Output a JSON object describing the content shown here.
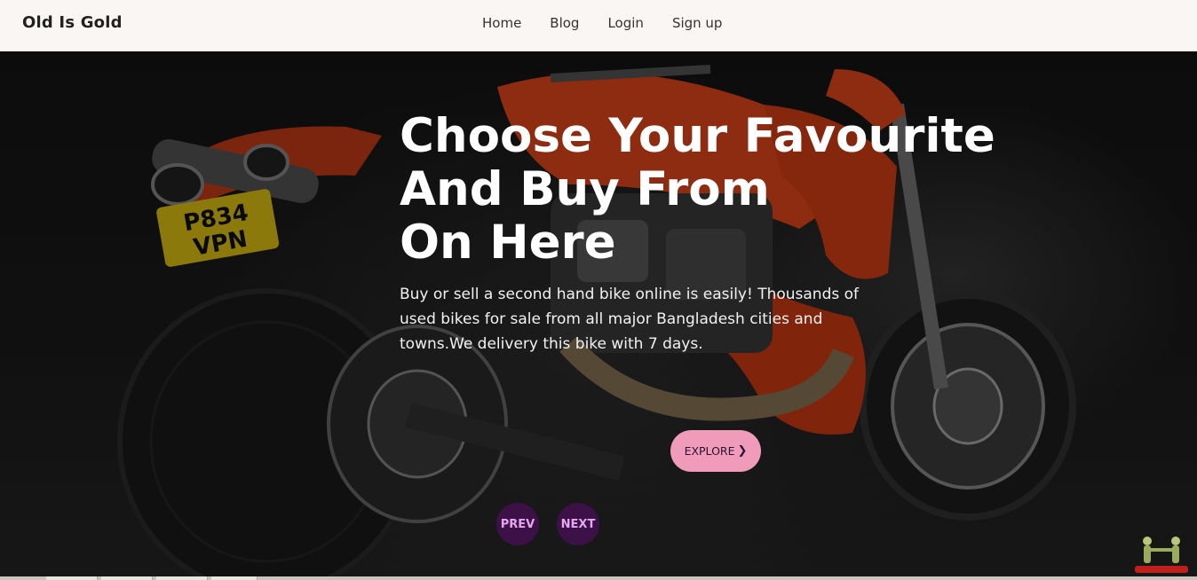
{
  "brand": {
    "name": "Old Is Gold"
  },
  "nav": {
    "items": [
      {
        "label": "Home"
      },
      {
        "label": "Blog"
      },
      {
        "label": "Login"
      },
      {
        "label": "Sign up"
      }
    ]
  },
  "hero": {
    "headline": "Choose Your Favourite\nAnd Buy From\nOn Here",
    "description": "Buy or sell a second hand bike online is easily! Thousands of used bikes for sale from all major Bangladesh cities and towns.We delivery this bike with 7 days.",
    "explore_label": "EXPLORE",
    "explore_icon": "chevron-right-icon",
    "prev_label": "PREV",
    "next_label": "NEXT",
    "plate_line1": "P834",
    "plate_line2": "VPN"
  },
  "colors": {
    "navbar_bg": "#f9f6f3",
    "explore_bg": "#f19bbb",
    "slider_btn_bg": "#3b1147",
    "slider_btn_text": "#e7a6f0",
    "bike_accent": "#e4471a"
  }
}
